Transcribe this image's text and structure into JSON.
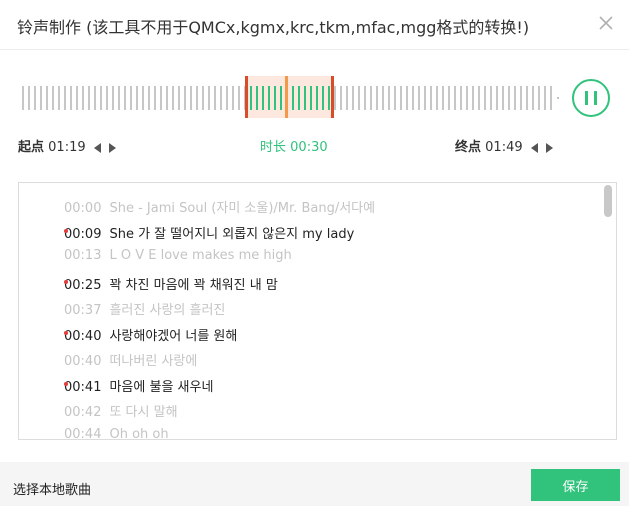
{
  "dialog": {
    "title": "铃声制作 (该工具不用于QMCx,kgmx,krc,tkm,mfac,mgg格式的转换!)",
    "close_icon": "close-icon"
  },
  "player": {
    "start_label": "起点",
    "start_time": "01:19",
    "duration_label": "时长",
    "duration_time": "00:30",
    "end_label": "终点",
    "end_time": "01:49",
    "play_icon": "pause-icon",
    "accent_color": "#31c27c",
    "marker_color": "#d94c2a"
  },
  "lyrics": [
    {
      "time": "00:00",
      "text": "She - Jami Soul (자미 소울)/Mr. Bang/서다예",
      "dark": false
    },
    {
      "time": "00:09",
      "text": "She 가 잘 떨어지니 외롭지 않은지 my lady",
      "dark": true
    },
    {
      "time": "00:13",
      "text": "L O V E love makes me high",
      "dark": false
    },
    {
      "time": "00:25",
      "text": "꽉 차진 마음에 꽉 채워진 내 맘",
      "dark": true
    },
    {
      "time": "00:37",
      "text": "흘러진 사랑의 흘러진",
      "dark": false
    },
    {
      "time": "00:40",
      "text": "사랑해야겠어 너를 원해",
      "dark": true
    },
    {
      "time": "00:40",
      "text": "떠나버린 사랑에",
      "dark": false
    },
    {
      "time": "00:41",
      "text": "마음에 불을 새우네",
      "dark": true
    },
    {
      "time": "00:42",
      "text": "또 다시 말해",
      "dark": false
    },
    {
      "time": "00:44",
      "text": "Oh oh oh",
      "dark": false
    }
  ],
  "footer": {
    "local_song_label": "选择本地歌曲",
    "save_label": "保存"
  }
}
